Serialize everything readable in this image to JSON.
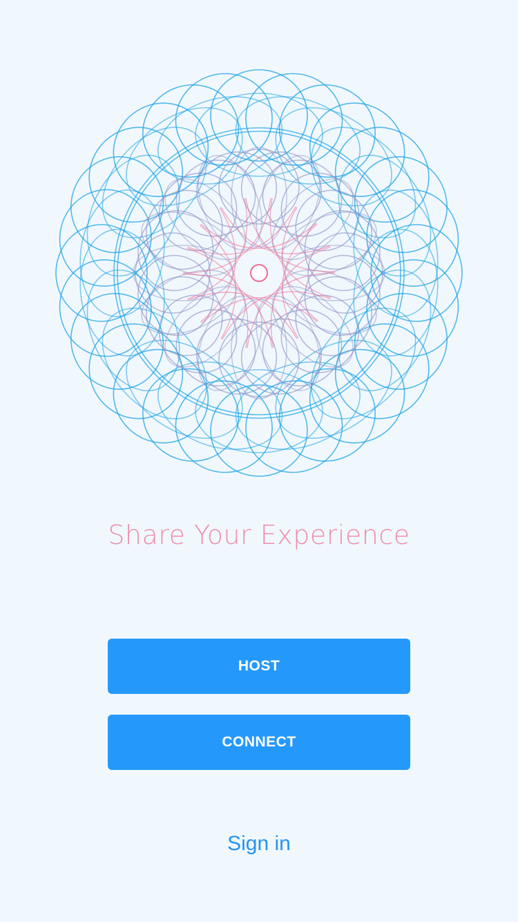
{
  "logo": {
    "icon": "spirograph-logo",
    "colors": {
      "outer": "#1aa3e6",
      "middle": "#8a8fc4",
      "inner": "#ee6a95",
      "center_dot": "#ffffff"
    }
  },
  "tagline": "Share Your Experience",
  "buttons": {
    "host_label": "HOST",
    "connect_label": "CONNECT"
  },
  "sign_in_label": "Sign in",
  "theme": {
    "background": "#f1f8fd",
    "accent": "#2599fb",
    "tagline_color": "#ef8cab",
    "link_color": "#2493f0"
  }
}
